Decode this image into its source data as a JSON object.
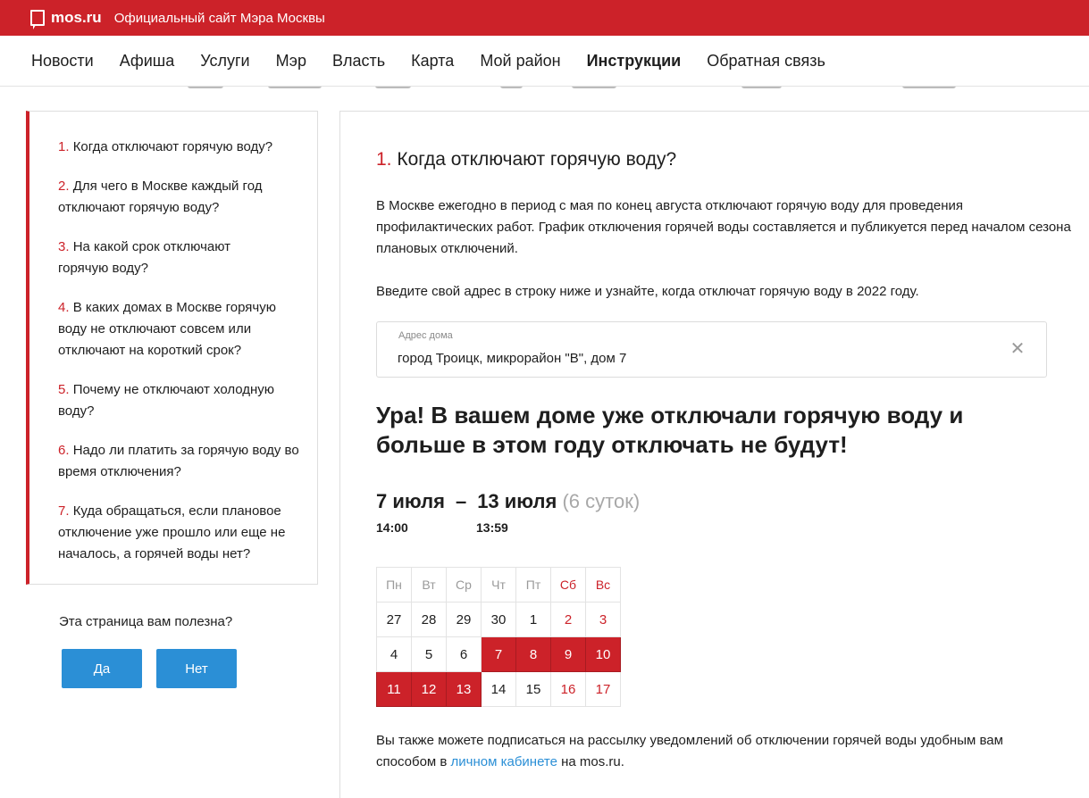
{
  "header": {
    "logo_text": "mos.ru",
    "site_title": "Официальный сайт Мэра Москвы"
  },
  "nav": {
    "items": [
      "Новости",
      "Афиша",
      "Услуги",
      "Мэр",
      "Власть",
      "Карта",
      "Мой район",
      "Инструкции",
      "Обратная связь"
    ],
    "active": "Инструкции"
  },
  "sidebar": {
    "items": [
      {
        "num": "1.",
        "text": "Когда отключают горячую воду?"
      },
      {
        "num": "2.",
        "text": "Для чего в Москве каждый год отключают горячую воду?"
      },
      {
        "num": "3.",
        "text": "На какой срок отключают горячую воду?"
      },
      {
        "num": "4.",
        "text": "В каких домах в Москве горячую воду не отключают совсем или отключают на короткий срок?"
      },
      {
        "num": "5.",
        "text": "Почему не отключают холодную воду?"
      },
      {
        "num": "6.",
        "text": "Надо ли платить за горячую воду во время отключения?"
      },
      {
        "num": "7.",
        "text": "Куда обращаться, если плановое отключение уже прошло или еще не началось, а горячей воды нет?"
      }
    ]
  },
  "feedback": {
    "question": "Эта страница вам полезна?",
    "yes_label": "Да",
    "no_label": "Нет"
  },
  "main": {
    "question_num": "1.",
    "question_title": "Когда отключают горячую воду?",
    "intro": "В Москве ежегодно в период с мая по конец августа отключают горячую воду для проведения профилактических работ. График отключения горячей воды составляется и публикуется перед началом сезона плановых отключений.",
    "prompt": "Введите свой адрес в строку ниже и узнайте, когда отключат горячую воду в 2022 году.",
    "address_label": "Адрес дома",
    "address_value": "город Троицк, микрорайон \"В\", дом 7",
    "result": "Ура! В вашем доме уже отключали горячую воду и больше в этом году отключать не будут!",
    "start_date": "7 июля",
    "dash": "–",
    "end_date": "13 июля",
    "duration": "(6 суток)",
    "start_time": "14:00",
    "end_time": "13:59",
    "note_before": "Вы также можете подписаться на рассылку уведомлений об отключении горячей воды удобным вам способом в ",
    "note_link": "личном кабинете",
    "note_after": " на mos.ru."
  },
  "calendar": {
    "weekdays": [
      "Пн",
      "Вт",
      "Ср",
      "Чт",
      "Пт",
      "Сб",
      "Вс"
    ],
    "weeks": [
      [
        "27",
        "28",
        "29",
        "30",
        "1",
        "2",
        "3"
      ],
      [
        "4",
        "5",
        "6",
        "7",
        "8",
        "9",
        "10"
      ],
      [
        "11",
        "12",
        "13",
        "14",
        "15",
        "16",
        "17"
      ]
    ],
    "outage_days": [
      "7",
      "8",
      "9",
      "10",
      "11",
      "12",
      "13"
    ],
    "accent_color": "#cc2229"
  }
}
